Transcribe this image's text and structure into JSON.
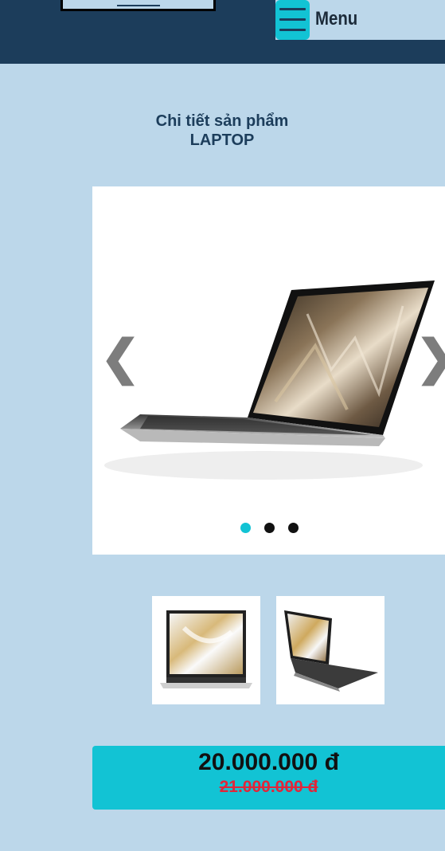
{
  "header": {
    "menu_label": "Menu"
  },
  "product": {
    "section_title": "Chi tiết sản phẩm",
    "category": "LAPTOP",
    "price": "20.000.000 đ",
    "old_price": "21.000.000 đ"
  },
  "carousel": {
    "prev_symbol": "❮",
    "next_symbol": "❯",
    "slide_count": 3,
    "active_slide": 1
  },
  "colors": {
    "header_bg": "#1c3d5b",
    "page_bg": "#bcd7ea",
    "accent": "#12c3d4",
    "old_price": "#e0263a"
  }
}
